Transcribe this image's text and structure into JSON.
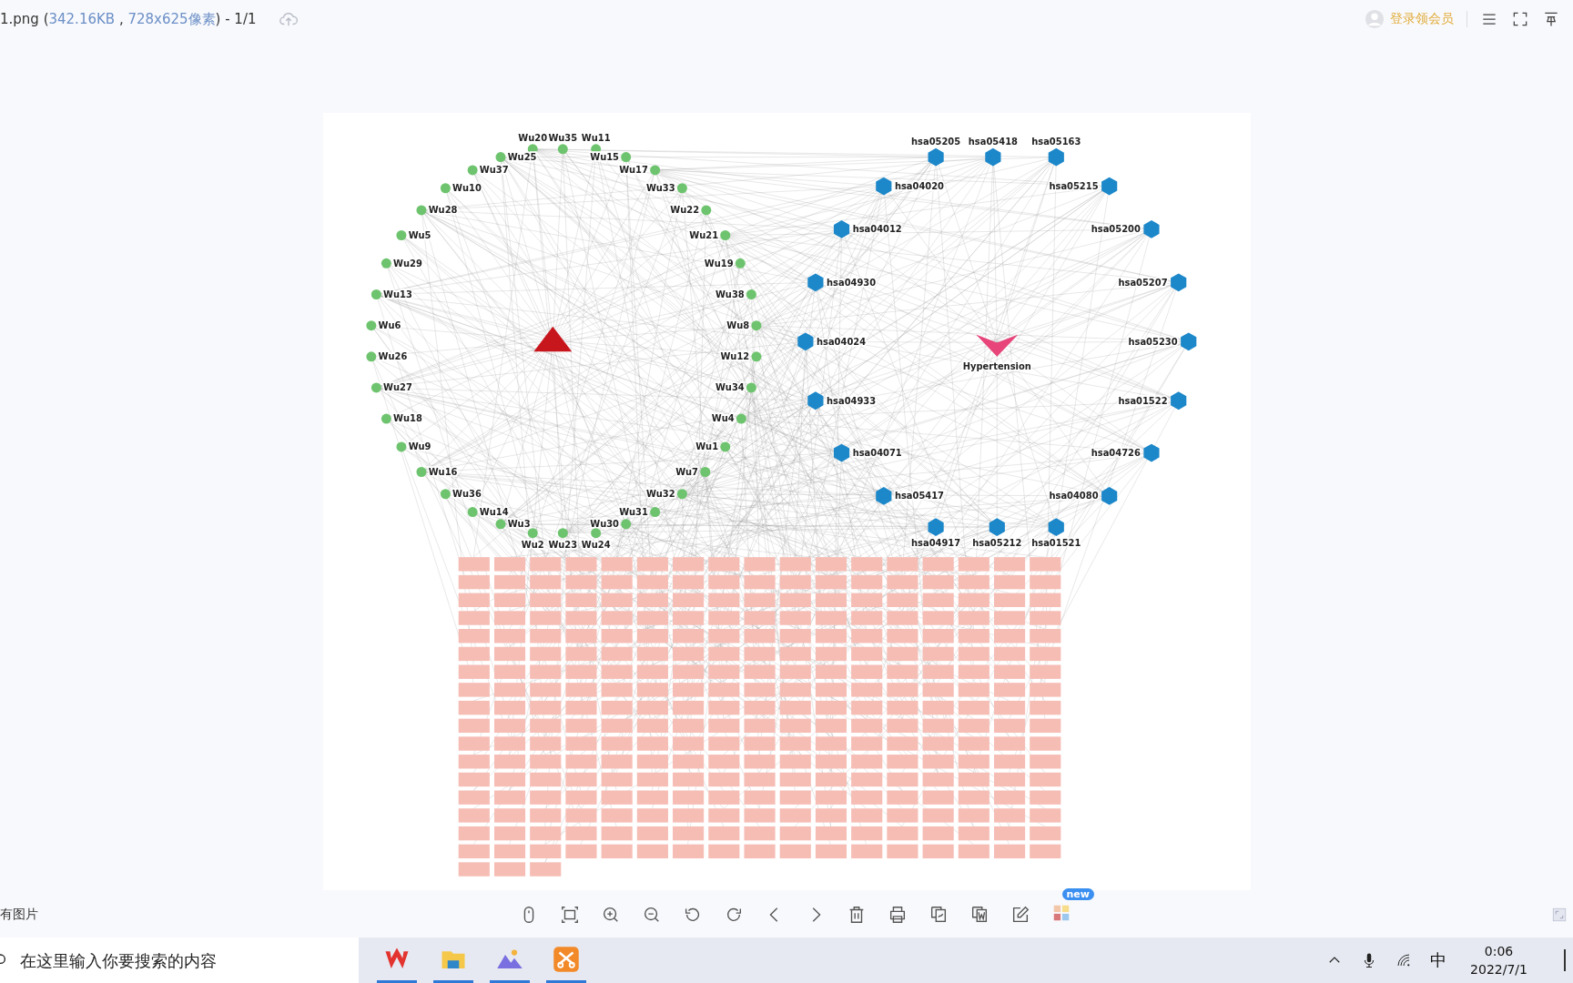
{
  "title_bar": {
    "file_name": "1.png (",
    "file_size": "342.16KB",
    "separator": " , ",
    "dimensions": "728x625像素",
    "suffix": ") - 1/1",
    "login_label": "登录领会员"
  },
  "network": {
    "compound_nodes": [
      "Wu20",
      "Wu35",
      "Wu11",
      "Wu25",
      "Wu15",
      "Wu37",
      "Wu17",
      "Wu10",
      "Wu33",
      "Wu28",
      "Wu22",
      "Wu5",
      "Wu21",
      "Wu29",
      "Wu19",
      "Wu13",
      "Wu38",
      "Wu6",
      "Wu8",
      "Wu26",
      "Wu12",
      "Wu27",
      "Wu34",
      "Wu18",
      "Wu4",
      "Wu9",
      "Wu1",
      "Wu16",
      "Wu7",
      "Wu36",
      "Wu32",
      "Wu14",
      "Wu31",
      "Wu3",
      "Wu30",
      "Wu2",
      "Wu23",
      "Wu24"
    ],
    "pathway_nodes": [
      "hsa05205",
      "hsa05418",
      "hsa05163",
      "hsa04020",
      "hsa05215",
      "hsa04012",
      "hsa05200",
      "hsa04930",
      "hsa05207",
      "hsa04024",
      "hsa05230",
      "hsa04933",
      "hsa01522",
      "hsa04071",
      "hsa04726",
      "hsa05417",
      "hsa04080",
      "hsa04917",
      "hsa05212",
      "hsa01521"
    ],
    "disease_label": "Hypertension"
  },
  "toolbar": {
    "new_badge": "new"
  },
  "thumbnail_label": "有图片",
  "taskbar": {
    "search_placeholder": "在这里输入你要搜索的内容",
    "ime": "中",
    "time": "0:06",
    "date": "2022/7/1"
  }
}
